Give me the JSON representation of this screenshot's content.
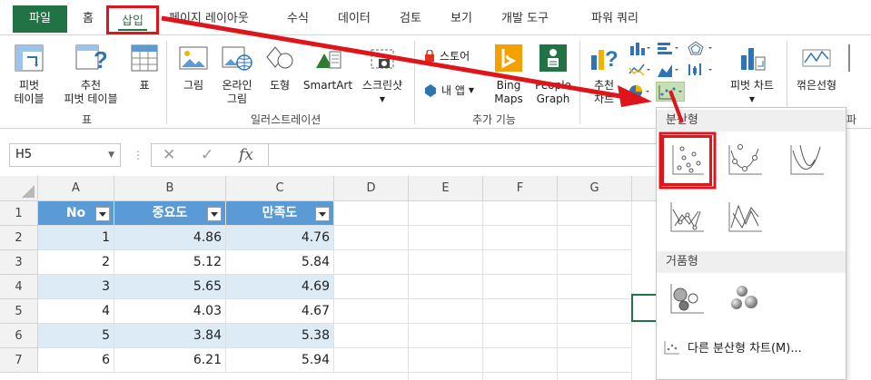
{
  "ribbon_tabs": [
    {
      "label": "파일"
    },
    {
      "label": "홈"
    },
    {
      "label": "삽입"
    },
    {
      "label": "페이지 레이아웃"
    },
    {
      "label": "수식"
    },
    {
      "label": "데이터"
    },
    {
      "label": "검토"
    },
    {
      "label": "보기"
    },
    {
      "label": "개발 도구"
    },
    {
      "label": "파워 쿼리"
    }
  ],
  "ribbon": {
    "tables": {
      "pivot_table": "피벗\n테이블",
      "recommended_pivot": "추천\n피벗 테이블",
      "table": "표",
      "group_label": "표"
    },
    "illustrations": {
      "pictures": "그림",
      "online_pictures": "온라인\n그림",
      "shapes": "도형",
      "smartart": "SmartArt",
      "screenshot": "스크린샷",
      "group_label": "일러스트레이션"
    },
    "addins": {
      "store": "스토어",
      "my_apps": "내 앱",
      "bing_maps": "Bing\nMaps",
      "people_graph": "People\nGraph",
      "group_label": "추가 기능"
    },
    "charts": {
      "recommended": "추천\n차트",
      "pivot_chart": "피벗 차트",
      "line": "꺾은선형",
      "cut_label": "파"
    }
  },
  "formula_bar": {
    "name_box": "H5",
    "cancel_icon": "✕",
    "enter_icon": "✓",
    "fx_label": "fx",
    "formula_value": ""
  },
  "sheet": {
    "columns": [
      "A",
      "B",
      "C",
      "D",
      "E",
      "F",
      "G"
    ],
    "rows": [
      "1",
      "2",
      "3",
      "4",
      "5",
      "6",
      "7"
    ],
    "headers": [
      "No",
      "중요도",
      "만족도"
    ],
    "data": [
      [
        "1",
        "4.86",
        "4.76"
      ],
      [
        "2",
        "5.12",
        "5.84"
      ],
      [
        "3",
        "5.65",
        "4.69"
      ],
      [
        "4",
        "4.03",
        "4.67"
      ],
      [
        "5",
        "3.84",
        "5.38"
      ],
      [
        "6",
        "6.21",
        "5.94"
      ]
    ]
  },
  "chart_dropdown": {
    "section_scatter": "분산형",
    "section_bubble": "거품형",
    "more_scatter": "다른 분산형 차트(M)...",
    "scatter_items": [
      "scatter",
      "scatter-smooth-markers",
      "scatter-smooth",
      "scatter-straight-markers",
      "scatter-straight"
    ],
    "bubble_items": [
      "bubble",
      "bubble-3d"
    ]
  },
  "colors": {
    "excel_green": "#217346",
    "highlight_red": "#e0141b",
    "table_header_blue": "#5b9bd5",
    "band_blue": "#ddebf7"
  }
}
